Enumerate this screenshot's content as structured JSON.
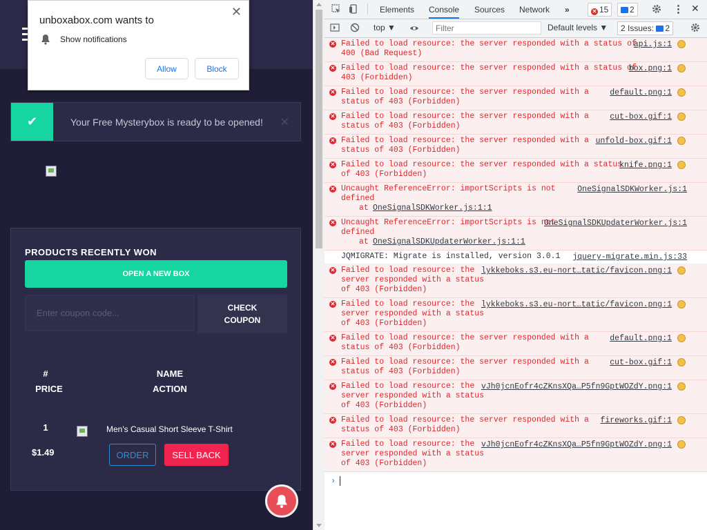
{
  "notification_popup": {
    "title": "unboxabox.com wants to",
    "description": "Show notifications",
    "allow_label": "Allow",
    "block_label": "Block",
    "close_glyph": "✕"
  },
  "site": {
    "notice": {
      "text": "Your Free Mysterybox is ready to be opened!",
      "close_glyph": "✕"
    },
    "won_panel": {
      "title": "PRODUCTS RECENTLY WON",
      "open_box_label": "OPEN A NEW BOX",
      "coupon_placeholder": "Enter coupon code...",
      "check_coupon_line1": "CHECK",
      "check_coupon_line2": "COUPON",
      "headers": {
        "hash": "#",
        "price": "PRICE",
        "name": "NAME",
        "action": "ACTION"
      },
      "rows": [
        {
          "number": "1",
          "price": "$1.49",
          "name": "Men's Casual Short Sleeve T-Shirt",
          "order_label": "ORDER",
          "sell_back_label": "SELL BACK"
        }
      ]
    },
    "colors": {
      "accent": "#17d5a0",
      "danger": "#f0244f",
      "order": "#2e8fd6",
      "bell": "#e84e57"
    }
  },
  "devtools": {
    "tabs": [
      "Elements",
      "Console",
      "Sources",
      "Network"
    ],
    "active_tab": "Console",
    "error_count": "15",
    "message_count": "2",
    "toolbar": {
      "context": "top",
      "filter_placeholder": "Filter",
      "levels": "Default levels",
      "issues_label": "2 Issues:",
      "issues_count": "2"
    },
    "entries": [
      {
        "type": "error",
        "msg": "Failed to load resource: the server responded with a status of\n400 (Bad Request)",
        "src": "api.js:1",
        "net": true
      },
      {
        "type": "error",
        "msg": "Failed to load resource: the server responded with a status of\n403 (Forbidden)",
        "src": "box.png:1",
        "net": true
      },
      {
        "type": "error",
        "msg": "Failed to load resource: the server responded with a\nstatus of 403 (Forbidden)",
        "src": "default.png:1",
        "net": true
      },
      {
        "type": "error",
        "msg": "Failed to load resource: the server responded with a\nstatus of 403 (Forbidden)",
        "src": "cut-box.gif:1",
        "net": true
      },
      {
        "type": "error",
        "msg": "Failed to load resource: the server responded with a\nstatus of 403 (Forbidden)",
        "src": "unfold-box.gif:1",
        "net": true
      },
      {
        "type": "error",
        "msg": "Failed to load resource: the server responded with a status\nof 403 (Forbidden)",
        "src": "knife.png:1",
        "net": true
      },
      {
        "type": "error",
        "msg": "Uncaught ReferenceError: importScripts is not\ndefined",
        "src": "OneSignalSDKWorker.js:1",
        "at": "OneSignalSDKWorker.js:1:1",
        "net": false
      },
      {
        "type": "error",
        "msg": "Uncaught ReferenceError: importScripts is not\ndefined",
        "src": "OneSignalSDKUpdaterWorker.js:1",
        "at": "OneSignalSDKUpdaterWorker.js:1:1",
        "net": false
      },
      {
        "type": "info",
        "msg": "JQMIGRATE: Migrate is installed, version 3.0.1",
        "src": "jquery-migrate.min.js:33",
        "net": false
      },
      {
        "type": "error",
        "msg": "Failed to load resource: the\nserver responded with a status\nof 403 (Forbidden)",
        "src": "lykkeboks.s3.eu-nort…tatic/favicon.png:1",
        "net": true
      },
      {
        "type": "error",
        "msg": "Failed to load resource: the\nserver responded with a status\nof 403 (Forbidden)",
        "src": "lykkeboks.s3.eu-nort…tatic/favicon.png:1",
        "net": true
      },
      {
        "type": "error",
        "msg": "Failed to load resource: the server responded with a\nstatus of 403 (Forbidden)",
        "src": "default.png:1",
        "net": true
      },
      {
        "type": "error",
        "msg": "Failed to load resource: the server responded with a\nstatus of 403 (Forbidden)",
        "src": "cut-box.gif:1",
        "net": true
      },
      {
        "type": "error",
        "msg": "Failed to load resource: the\nserver responded with a status\nof 403 (Forbidden)",
        "src": "vJh0jcnEofr4cZKnsXQa…P5fn9GptWOZdY.png:1",
        "net": true
      },
      {
        "type": "error",
        "msg": "Failed to load resource: the server responded with a\nstatus of 403 (Forbidden)",
        "src": "fireworks.gif:1",
        "net": true
      },
      {
        "type": "error",
        "msg": "Failed to load resource: the\nserver responded with a status\nof 403 (Forbidden)",
        "src": "vJh0jcnEofr4cZKnsXQa…P5fn9GptWOZdY.png:1",
        "net": true
      }
    ],
    "prompt_glyph": "›"
  }
}
